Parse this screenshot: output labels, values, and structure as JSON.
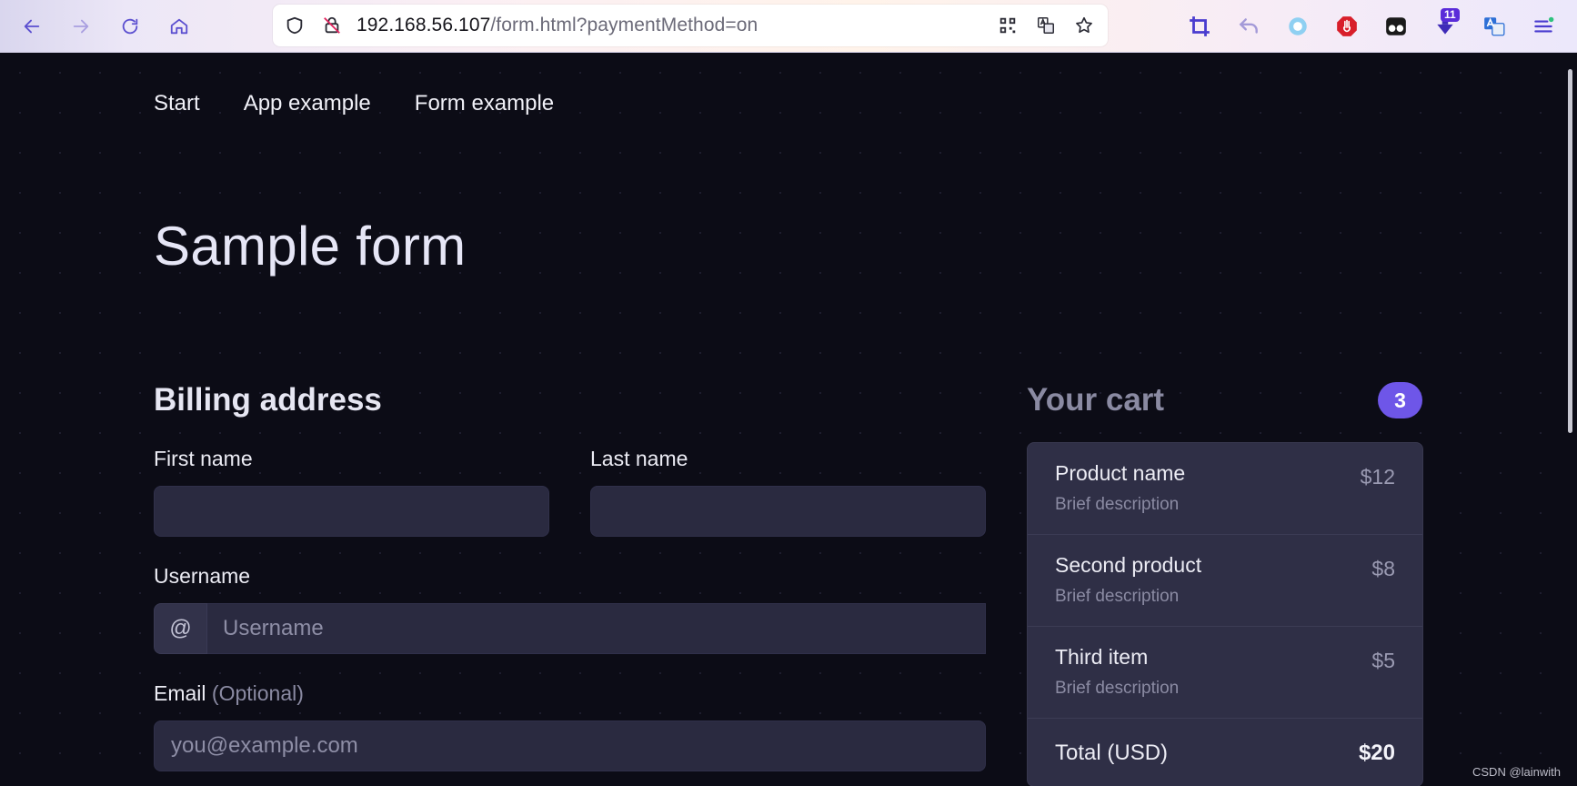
{
  "browser": {
    "url_host": "192.168.56.107",
    "url_path": "/form.html?paymentMethod=on",
    "extensions": {
      "download_badge": "11"
    },
    "icons": {
      "back": "arrow-left-icon",
      "forward": "arrow-right-icon",
      "reload": "reload-icon",
      "home": "home-icon",
      "shield": "shield-icon",
      "insecure": "insecure-lock-icon",
      "qr": "qr-code-icon",
      "translate": "translate-icon",
      "bookmark": "star-icon"
    }
  },
  "nav": {
    "items": [
      {
        "label": "Start"
      },
      {
        "label": "App example"
      },
      {
        "label": "Form example"
      }
    ]
  },
  "page": {
    "title": "Sample form"
  },
  "billing": {
    "title": "Billing address",
    "first_name_label": "First name",
    "first_name_value": "",
    "last_name_label": "Last name",
    "last_name_value": "",
    "username_label": "Username",
    "username_addon": "@",
    "username_placeholder": "Username",
    "email_label": "Email",
    "email_optional": "(Optional)",
    "email_placeholder": "you@example.com"
  },
  "cart": {
    "title": "Your cart",
    "count": "3",
    "items": [
      {
        "name": "Product name",
        "description": "Brief description",
        "price": "$12"
      },
      {
        "name": "Second product",
        "description": "Brief description",
        "price": "$8"
      },
      {
        "name": "Third item",
        "description": "Brief description",
        "price": "$5"
      }
    ],
    "total_label": "Total (USD)",
    "total_value": "$20"
  },
  "watermark": "CSDN @lainwith",
  "colors": {
    "background": "#0c0c16",
    "input_bg": "#2a2a40",
    "accent": "#6e56e8"
  }
}
